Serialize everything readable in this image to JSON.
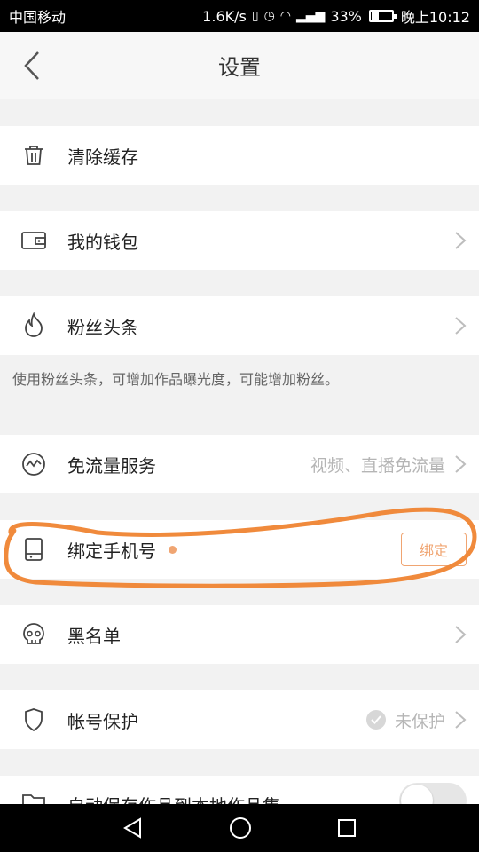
{
  "status_bar": {
    "carrier": "中国移动",
    "speed": "1.6K/s",
    "battery": "33%",
    "time": "晚上10:12"
  },
  "header": {
    "title": "设置"
  },
  "settings": {
    "clear_cache": "清除缓存",
    "wallet": "我的钱包",
    "fans_headline": "粉丝头条",
    "fans_hint": "使用粉丝头条，可增加作品曝光度，可能增加粉丝。",
    "free_data": "免流量服务",
    "free_data_value": "视频、直播免流量",
    "bind_phone": "绑定手机号",
    "bind_button": "绑定",
    "blacklist": "黑名单",
    "account_protect": "帐号保护",
    "account_protect_value": "未保护",
    "auto_save": "自动保存作品到本地作品集"
  },
  "annotation": {
    "color": "#f08a3c"
  },
  "icons": [
    "back-arrow-icon",
    "trash-icon",
    "wallet-icon",
    "flame-icon",
    "wave-icon",
    "phone-icon",
    "skull-icon",
    "shield-icon",
    "folder-icon",
    "chevron-right-icon",
    "check-icon",
    "triangle-back-icon",
    "circle-home-icon",
    "square-recent-icon"
  ]
}
